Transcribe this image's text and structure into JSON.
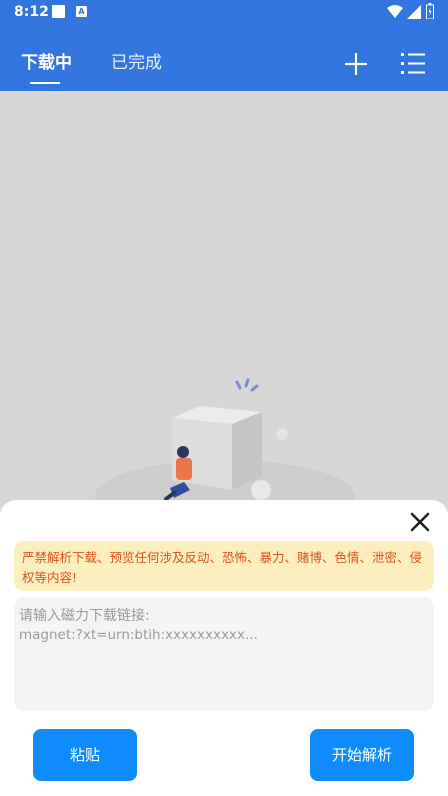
{
  "status_bar": {
    "time": "8:12",
    "icon_left_1": "square-icon",
    "icon_left_2": "a-icon"
  },
  "tabs": [
    {
      "label": "下载中",
      "active": true
    },
    {
      "label": "已完成",
      "active": false
    }
  ],
  "header_icons": [
    "plus-icon",
    "list-menu-icon"
  ],
  "sheet": {
    "warning": "严禁解析下载、预览任何涉及反动、恐怖、暴力、赌博、色情、泄密、侵权等内容!",
    "input_placeholder_line1": "请输入磁力下载链接:",
    "input_placeholder_line2": "magnet:?xt=urn:btih:xxxxxxxxxx...",
    "paste_label": "粘贴",
    "parse_label": "开始解析"
  },
  "colors": {
    "header": "#3275de",
    "warning_bg": "#fdefbd",
    "warning_text": "#d9531e",
    "button": "#0e8cff"
  }
}
